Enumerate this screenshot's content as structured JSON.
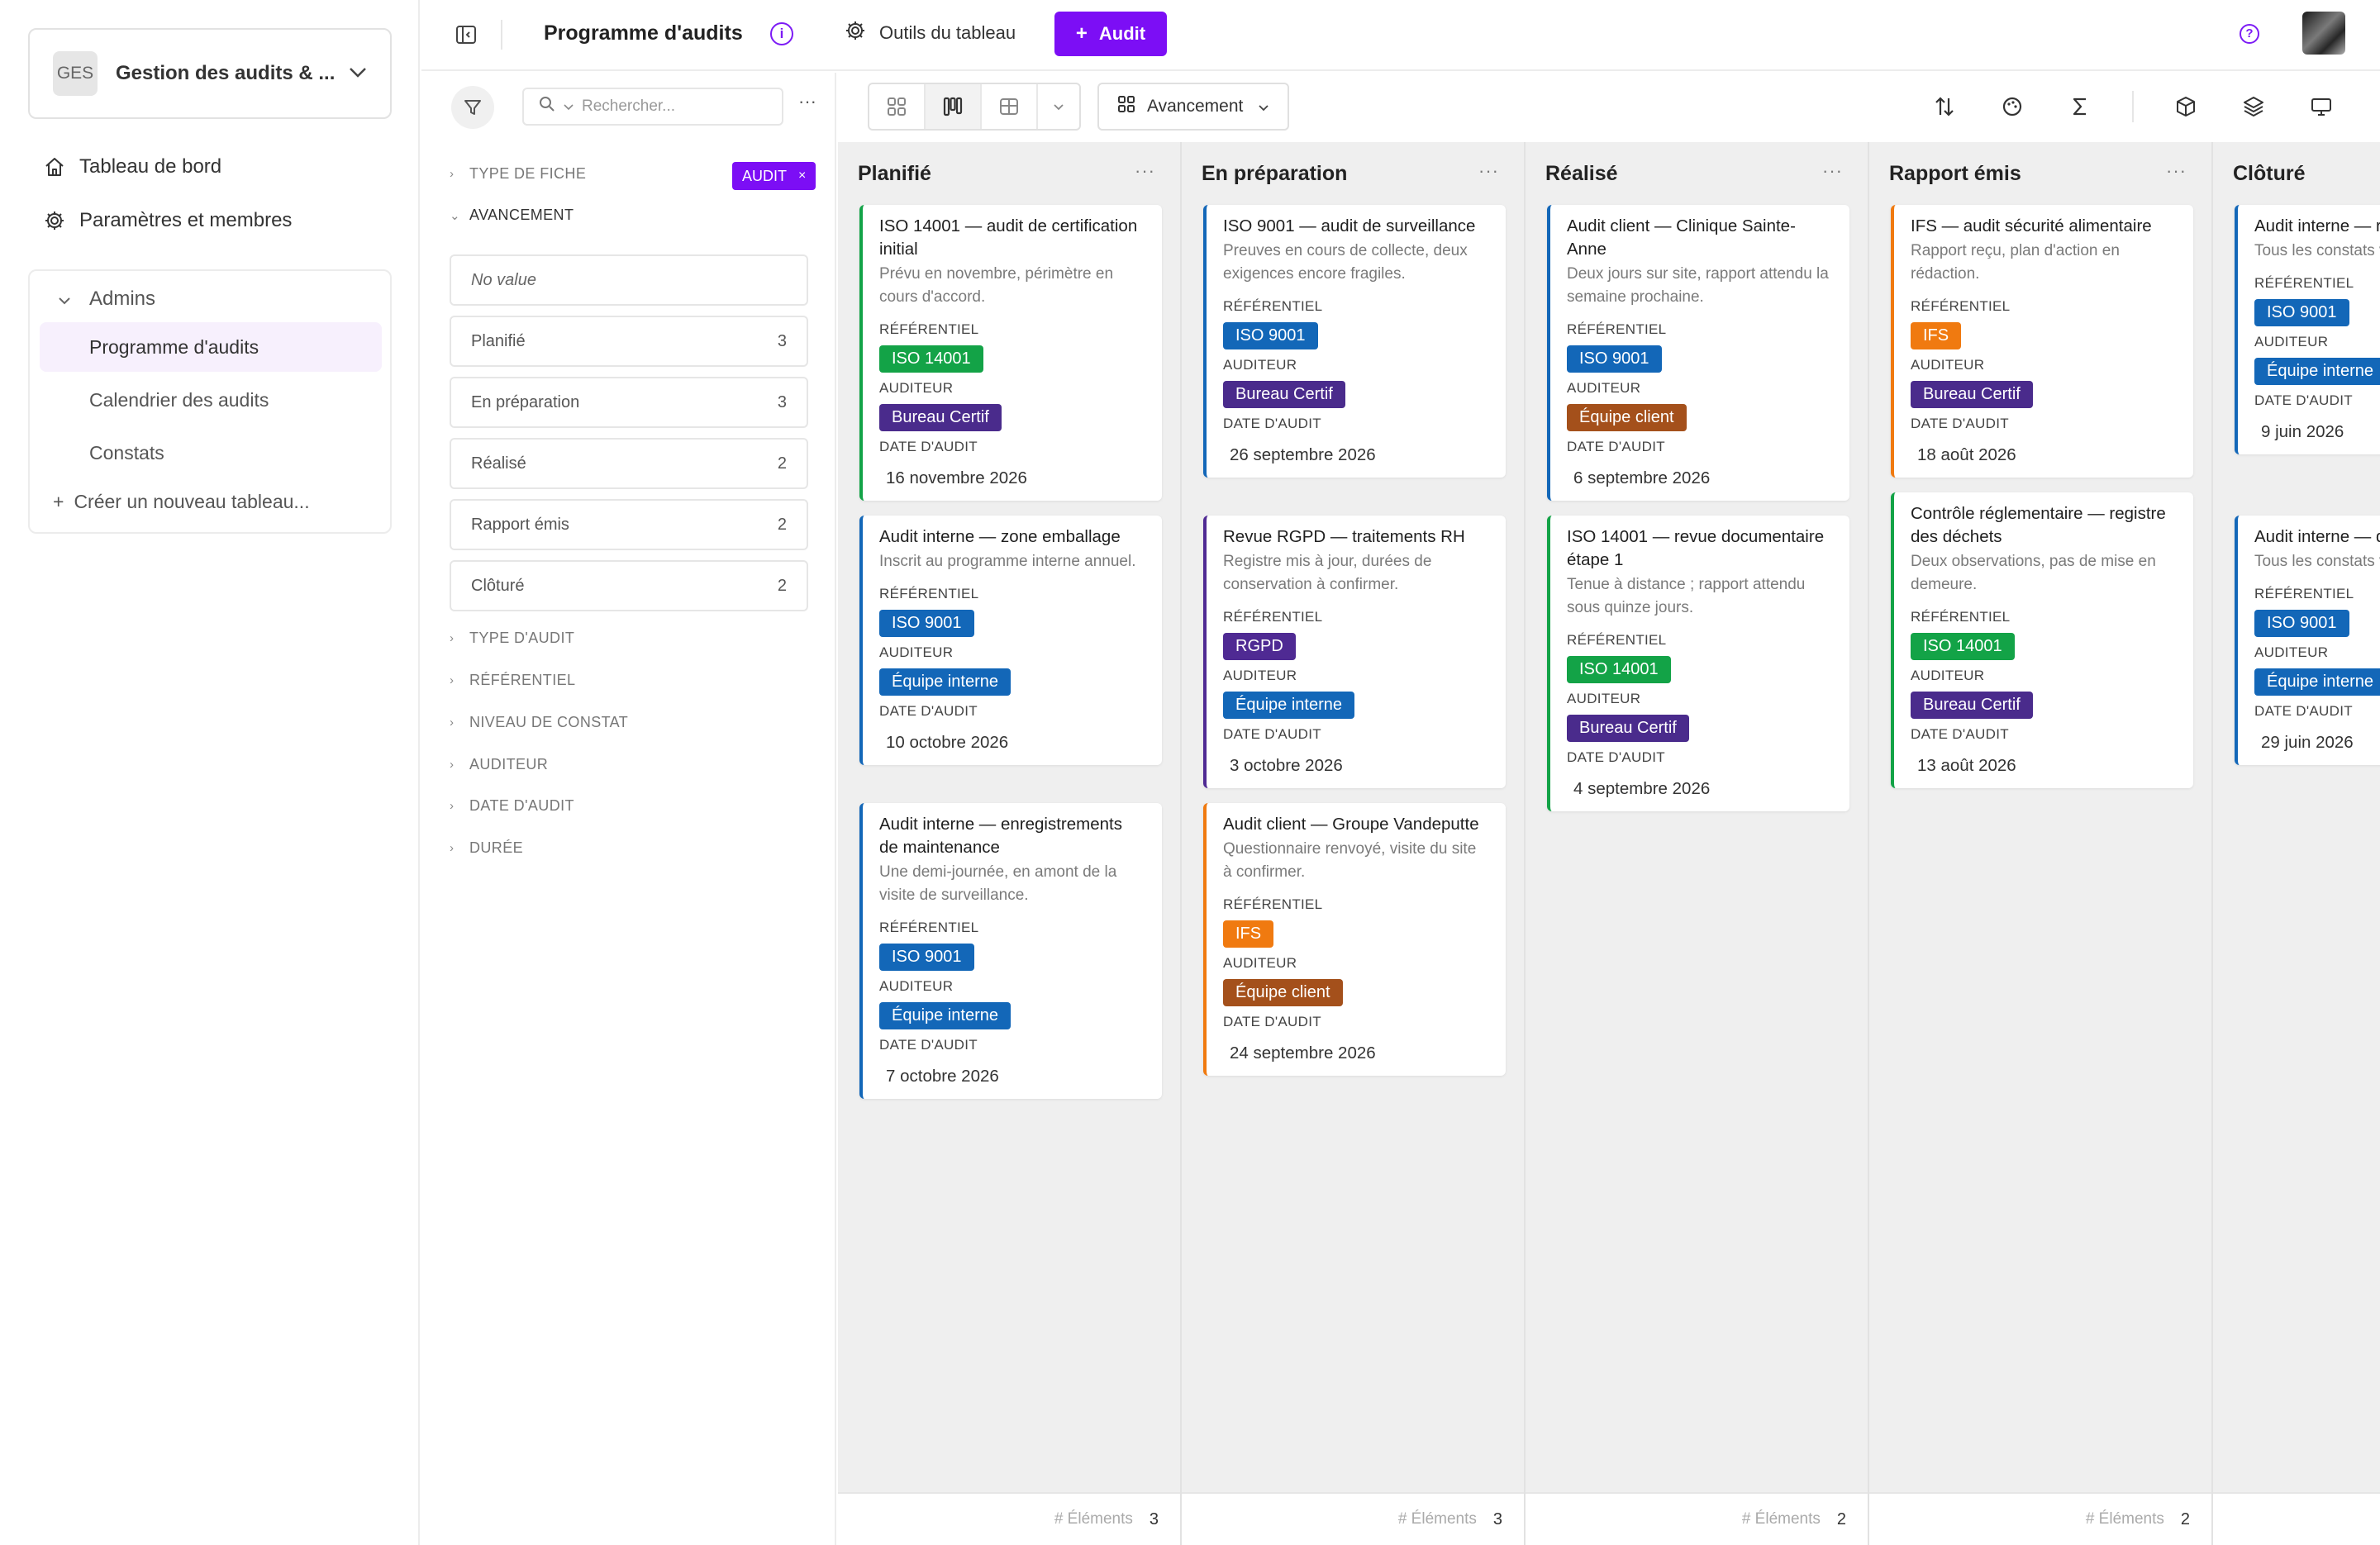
{
  "workspace": {
    "badge": "GES",
    "name": "Gestion des audits & ..."
  },
  "nav": {
    "dashboard": "Tableau de bord",
    "settings": "Paramètres et membres"
  },
  "group": {
    "title": "Admins",
    "items": [
      "Programme d'audits",
      "Calendrier des audits",
      "Constats"
    ],
    "new_board": "Créer un nouveau tableau..."
  },
  "topbar": {
    "title": "Programme d'audits",
    "tools": "Outils du tableau",
    "add": "Audit"
  },
  "filters": {
    "search_placeholder": "Rechercher...",
    "more": "···",
    "type_fiche": "TYPE DE FICHE",
    "active_tag": "AUDIT",
    "avancement": "AVANCEMENT",
    "options": [
      {
        "label": "No value",
        "count": ""
      },
      {
        "label": "Planifié",
        "count": "3"
      },
      {
        "label": "En préparation",
        "count": "3"
      },
      {
        "label": "Réalisé",
        "count": "2"
      },
      {
        "label": "Rapport émis",
        "count": "2"
      },
      {
        "label": "Clôturé",
        "count": "2"
      }
    ],
    "other": [
      "TYPE D'AUDIT",
      "RÉFÉRENTIEL",
      "NIVEAU DE CONSTAT",
      "AUDITEUR",
      "DATE D'AUDIT",
      "DURÉE"
    ]
  },
  "toolbar": {
    "group_by": "Avancement"
  },
  "labels": {
    "referentiel": "RÉFÉRENTIEL",
    "auditeur": "AUDITEUR",
    "date": "DATE D'AUDIT",
    "elements": "# Éléments",
    "more": "···"
  },
  "colors": {
    "accent": "#7c0ef5",
    "ISO 14001": "#13a347",
    "ISO 9001": "#1367b8",
    "IFS": "#f07a10",
    "RGPD": "#4f2a93",
    "Bureau Certif": "#4a2b8c",
    "Équipe interne": "#1367b8",
    "Équipe client": "#a4501b"
  },
  "columns": [
    {
      "title": "Planifié",
      "count": "3",
      "cards": [
        {
          "title": "ISO 14001 — audit de certification initial",
          "desc": "Prévu en novembre, périmètre en cours d'accord.",
          "ref": "ISO 14001",
          "auditor": "Bureau Certif",
          "date": "16 novembre 2026",
          "accent": "#13a347"
        },
        {
          "title": "Audit interne — zone emballage",
          "desc": "Inscrit au programme interne annuel.",
          "ref": "ISO 9001",
          "auditor": "Équipe interne",
          "date": "10 octobre 2026",
          "accent": "#1367b8"
        },
        {
          "title": "Audit interne — enregistrements de maintenance",
          "desc": "Une demi-journée, en amont de la visite de surveillance.",
          "ref": "ISO 9001",
          "auditor": "Équipe interne",
          "date": "7 octobre 2026",
          "accent": "#1367b8"
        }
      ]
    },
    {
      "title": "En préparation",
      "count": "3",
      "cards": [
        {
          "title": "ISO 9001 — audit de surveillance",
          "desc": "Preuves en cours de collecte, deux exigences encore fragiles.",
          "ref": "ISO 9001",
          "auditor": "Bureau Certif",
          "date": "26 septembre 2026",
          "accent": "#1367b8"
        },
        {
          "title": "Revue RGPD — traitements RH",
          "desc": "Registre mis à jour, durées de conservation à confirmer.",
          "ref": "RGPD",
          "auditor": "Équipe interne",
          "date": "3 octobre 2026",
          "accent": "#4f2a93"
        },
        {
          "title": "Audit client — Groupe Vandeputte",
          "desc": "Questionnaire renvoyé, visite du site à confirmer.",
          "ref": "IFS",
          "auditor": "Équipe client",
          "date": "24 septembre 2026",
          "accent": "#f07a10"
        }
      ]
    },
    {
      "title": "Réalisé",
      "count": "2",
      "cards": [
        {
          "title": "Audit client — Clinique Sainte-Anne",
          "desc": "Deux jours sur site, rapport attendu la semaine prochaine.",
          "ref": "ISO 9001",
          "auditor": "Équipe client",
          "date": "6 septembre 2026",
          "accent": "#1367b8"
        },
        {
          "title": "ISO 14001 — revue documentaire étape 1",
          "desc": "Tenue à distance ; rapport attendu sous quinze jours.",
          "ref": "ISO 14001",
          "auditor": "Bureau Certif",
          "date": "4 septembre 2026",
          "accent": "#13a347"
        }
      ]
    },
    {
      "title": "Rapport émis",
      "count": "2",
      "cards": [
        {
          "title": "IFS — audit sécurité alimentaire",
          "desc": "Rapport reçu, plan d'action en rédaction.",
          "ref": "IFS",
          "auditor": "Bureau Certif",
          "date": "18 août 2026",
          "accent": "#f07a10"
        },
        {
          "title": "Contrôle réglementaire — registre des déchets",
          "desc": "Deux observations, pas de mise en demeure.",
          "ref": "ISO 14001",
          "auditor": "Bureau Certif",
          "date": "13 août 2026",
          "accent": "#13a347"
        }
      ]
    },
    {
      "title": "Clôturé",
      "count": "2",
      "cards": [
        {
          "title": "Audit interne — réception",
          "desc": "Tous les constats vérifiés.",
          "ref": "ISO 9001",
          "auditor": "Équipe interne",
          "date": "9 juin 2026",
          "accent": "#1367b8"
        },
        {
          "title": "Audit interne — documentaire",
          "desc": "Tous les constats vérifiés.",
          "ref": "ISO 9001",
          "auditor": "Équipe interne",
          "date": "29 juin 2026",
          "accent": "#1367b8"
        }
      ]
    }
  ]
}
